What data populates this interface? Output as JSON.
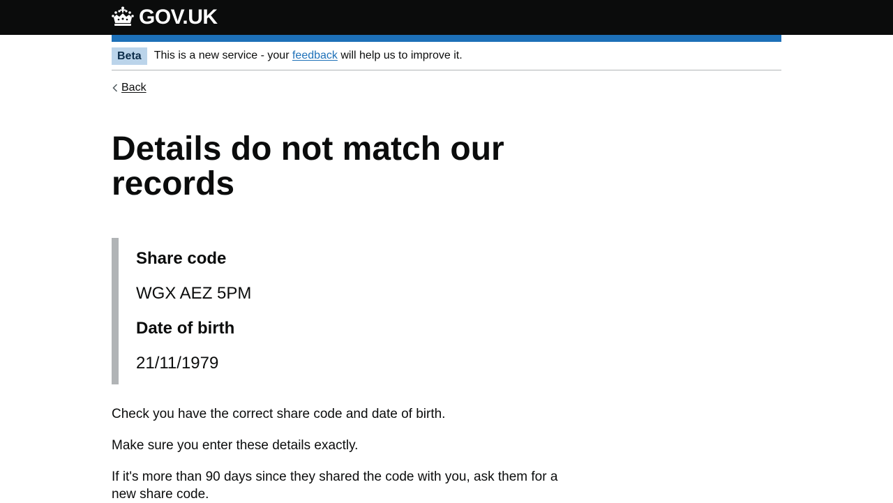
{
  "header": {
    "logo_text": "GOV.UK",
    "logo_icon": "crown-icon",
    "brand_color": "#0b0c0c",
    "accent_color": "#1d70b8"
  },
  "phase_banner": {
    "tag": "Beta",
    "text_before": "This is a new service - your ",
    "link_text": "feedback",
    "text_after": " will help us to improve it."
  },
  "back_link": {
    "label": "Back",
    "icon": "chevron-left-icon"
  },
  "main": {
    "title": "Details do not match our records",
    "details": {
      "share_code_label": "Share code",
      "share_code_value": "WGX AEZ 5PM",
      "dob_label": "Date of birth",
      "dob_value": "21/11/1979"
    },
    "paragraphs": [
      "Check you have the correct share code and date of birth.",
      "Make sure you enter these details exactly.",
      "If it's more than 90 days since they shared the code with you, ask them for a new share code."
    ]
  }
}
